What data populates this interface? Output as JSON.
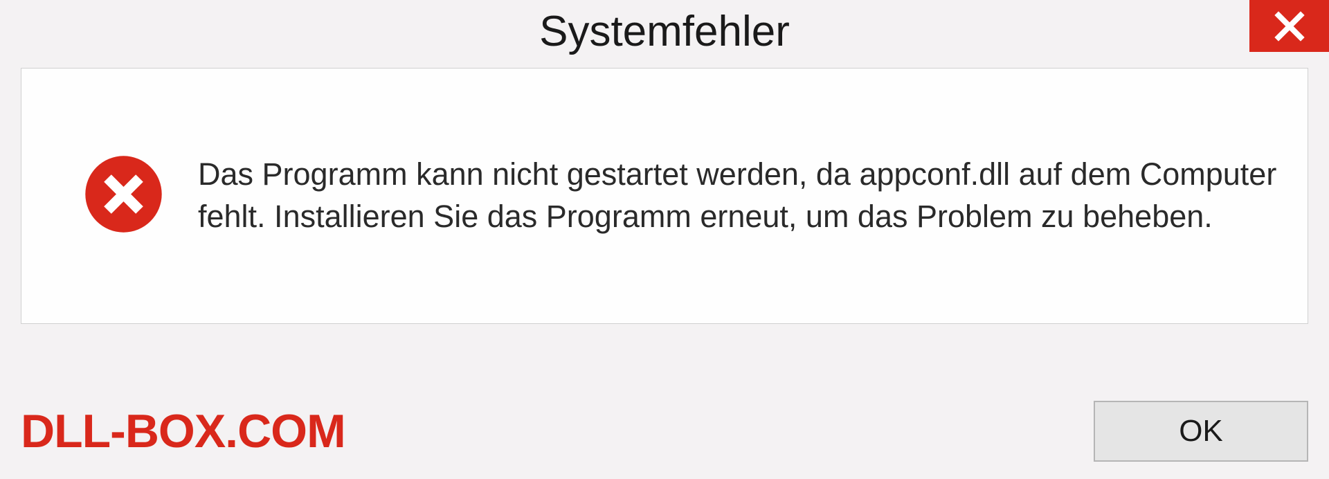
{
  "dialog": {
    "title": "Systemfehler",
    "message": "Das Programm kann nicht gestartet werden, da appconf.dll auf dem Computer fehlt. Installieren Sie das Programm erneut, um das Problem zu beheben.",
    "ok_label": "OK"
  },
  "watermark": "DLL-BOX.COM"
}
